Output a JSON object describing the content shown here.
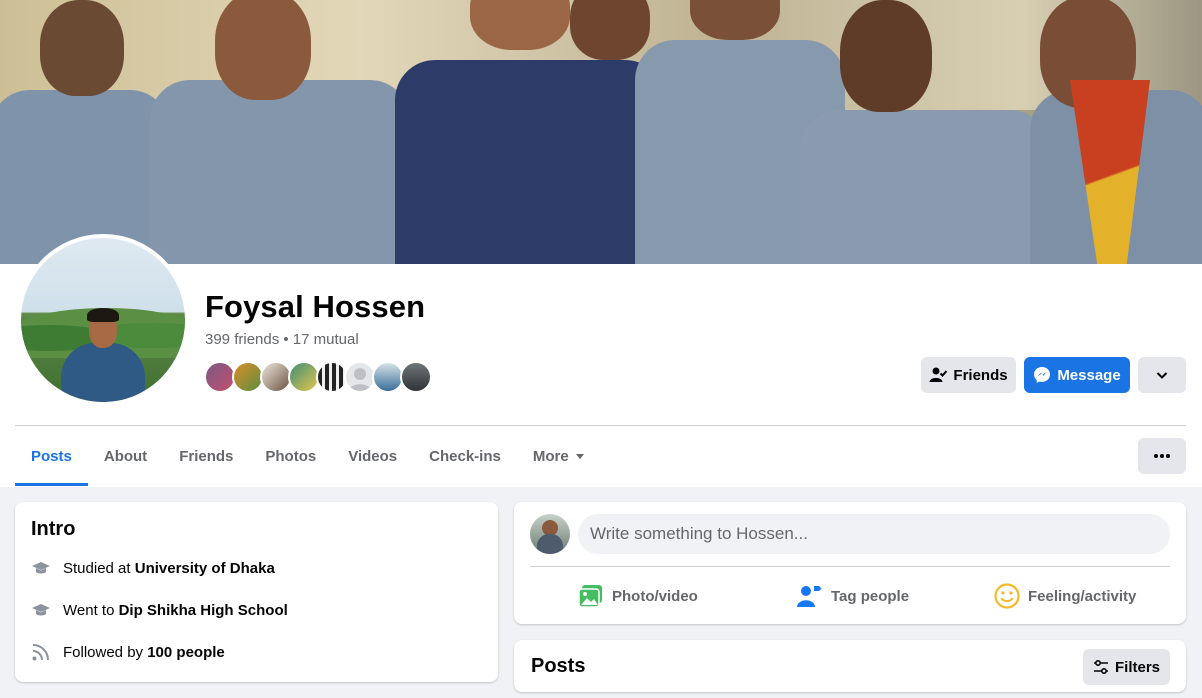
{
  "profile": {
    "name": "Foysal Hossen",
    "friends_summary": "399 friends • 17 mutual"
  },
  "actions": {
    "friends_label": "Friends",
    "message_label": "Message"
  },
  "tabs": [
    {
      "label": "Posts",
      "active": true
    },
    {
      "label": "About",
      "active": false
    },
    {
      "label": "Friends",
      "active": false
    },
    {
      "label": "Photos",
      "active": false
    },
    {
      "label": "Videos",
      "active": false
    },
    {
      "label": "Check-ins",
      "active": false
    },
    {
      "label": "More",
      "active": false
    }
  ],
  "intro": {
    "title": "Intro",
    "items": [
      {
        "prefix": "Studied at",
        "value": "University of Dhaka",
        "icon": "graduation-cap-icon"
      },
      {
        "prefix": "Went to",
        "value": "Dip Shikha High School",
        "icon": "graduation-cap-icon"
      },
      {
        "prefix": "Followed by",
        "value": "100 people",
        "icon": "rss-followers-icon"
      }
    ]
  },
  "composer": {
    "placeholder": "Write something to Hossen...",
    "actions": [
      {
        "label": "Photo/video",
        "icon": "photo-icon",
        "color": "#45bd62"
      },
      {
        "label": "Tag people",
        "icon": "tag-people-icon",
        "color": "#1877f2"
      },
      {
        "label": "Feeling/activity",
        "icon": "feeling-icon",
        "color": "#f7b928"
      }
    ]
  },
  "posts": {
    "title": "Posts",
    "filters_label": "Filters"
  },
  "colors": {
    "accent": "#1b74e4",
    "secondary_button": "#e4e6eb",
    "page_bg": "#f0f2f5"
  }
}
